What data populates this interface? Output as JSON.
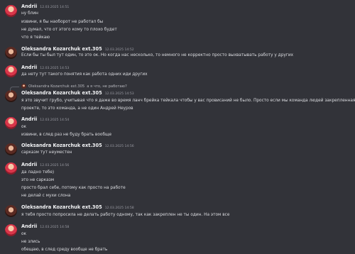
{
  "messages": [
    {
      "author": "Andrii",
      "avatar": "andrii",
      "time": "12.03.2025 14:51",
      "lines": [
        "ну блин",
        "извини, я бы наоборот не работал бы",
        "не думал, что от этого кому то плохо будет",
        "что я тейкаю"
      ]
    },
    {
      "author": "Oleksandra Kozarchuk ext.305",
      "avatar": "olek",
      "time": "12.03.2025 14:52",
      "lines": [
        "Если бы ты был тут один, то это ок. Но когда нас несколько, то немного не корректно просто выхватывать работу у других"
      ]
    },
    {
      "author": "Andrii",
      "avatar": "andrii",
      "time": "12.03.2025 14:53",
      "lines": [
        "да нету тут такого понятия как работа одних иди других"
      ]
    },
    {
      "author": "Oleksandra Kozarchuk ext.305",
      "avatar": "olek",
      "time": "12.03.2025 14:53",
      "reply": {
        "author": "Oleksandra Kozarchuk ext.305",
        "text": "а я что, не работаю?"
      },
      "lines": [
        "я это звучит грубо, учитывая что я даже во время ланч брейка тейкала чтобы у вас провисаний не было. Просто если мы команда людей закрепленная на",
        "проекте, то это команда, а не один Андрей Неуров"
      ]
    },
    {
      "author": "Andrii",
      "avatar": "andrii",
      "time": "12.03.2025 14:54",
      "lines": [
        "ок",
        "извини, в след раз не буду брать вообще"
      ]
    },
    {
      "author": "Oleksandra Kozarchuk ext.305",
      "avatar": "olek",
      "time": "12.03.2025 14:56",
      "lines": [
        "сарказм тут неуместен"
      ]
    },
    {
      "author": "Andrii",
      "avatar": "andrii",
      "time": "12.03.2025 14:56",
      "lines": [
        "да ладно тебе)",
        "это не сарказм",
        "просто брал себе, потому как просто на работе",
        "не делай с мухи слона"
      ]
    },
    {
      "author": "Oleksandra Kozarchuk ext.305",
      "avatar": "olek",
      "time": "12.03.2025 14:58",
      "lines": [
        "я тебя просто попросила не делать работу одному, так как закреплен не ты один. На этом все"
      ]
    },
    {
      "author": "Andrii",
      "avatar": "andrii",
      "time": "12.03.2025 14:58",
      "lines": [
        "ок",
        "не злись",
        "обещаю, в след среду вообще не брать"
      ]
    }
  ]
}
